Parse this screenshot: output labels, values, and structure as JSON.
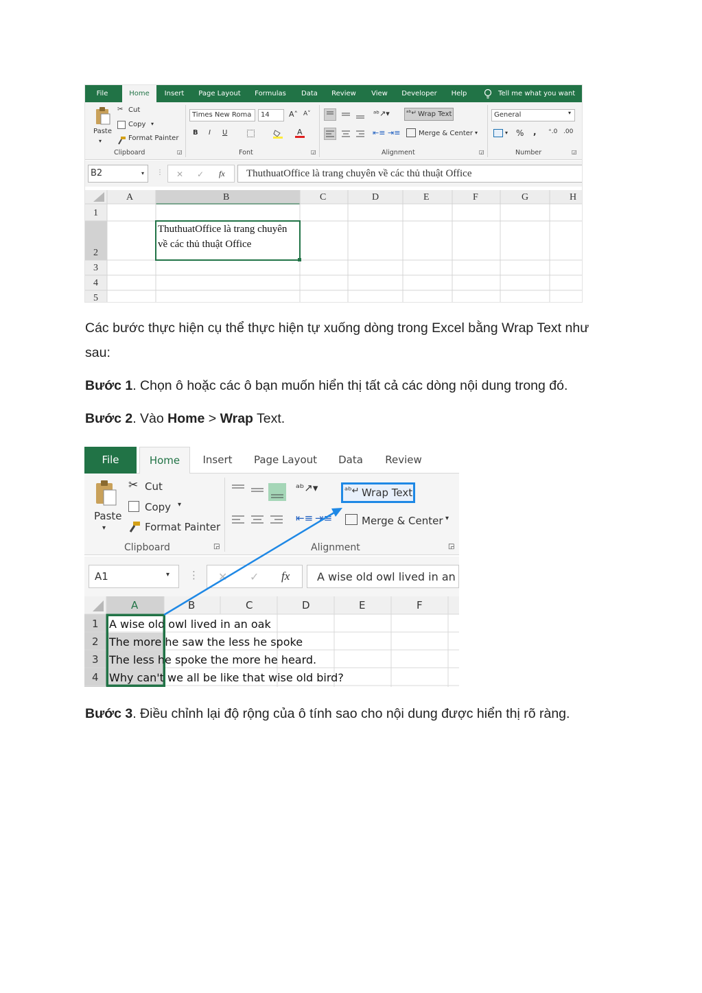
{
  "screenshot1": {
    "tabs": [
      "File",
      "Home",
      "Insert",
      "Page Layout",
      "Formulas",
      "Data",
      "Review",
      "View",
      "Developer",
      "Help"
    ],
    "tell_me": "Tell me what you want to",
    "clipboard": {
      "paste": "Paste",
      "cut": "Cut",
      "copy": "Copy",
      "format_painter": "Format Painter",
      "label": "Clipboard"
    },
    "font": {
      "name": "Times New Roma",
      "size": "14",
      "bold": "B",
      "italic": "I",
      "underline": "U",
      "label": "Font"
    },
    "alignment": {
      "wrap_text": "Wrap Text",
      "merge_center": "Merge & Center",
      "label": "Alignment"
    },
    "number": {
      "format": "General",
      "percent": "%",
      "comma": ",",
      "label": "Number"
    },
    "name_box": "B2",
    "fx": "fx",
    "formula": "ThuthuatOffice là trang chuyên về các thủ thuật Office",
    "columns": [
      "A",
      "B",
      "C",
      "D",
      "E",
      "F",
      "G",
      "H"
    ],
    "rows": [
      "1",
      "2",
      "3",
      "4",
      "5"
    ],
    "cell_b2_line1": "ThuthuatOffice là trang chuyên",
    "cell_b2_line2": "về các thủ thuật Office"
  },
  "text": {
    "intro_line1": "Các bước thực hiện cụ thể thực hiện tự xuống dòng trong Excel bằng Wrap Text như",
    "intro_line2": "sau:",
    "step1_label": "Bước 1",
    "step1_text": ". Chọn ô hoặc các ô bạn muốn hiển thị tất cả các dòng nội dung trong đó.",
    "step2_label": "Bước 2",
    "step2_text_a": ". Vào ",
    "step2_home": "Home",
    "step2_sep": " > ",
    "step2_wrap": "Wrap",
    "step2_text_b": " Text.",
    "step3_label": "Bước 3",
    "step3_text": ". Điều chỉnh lại độ rộng của ô tính sao cho nội dung được hiển thị rõ ràng."
  },
  "screenshot2": {
    "tabs": [
      "File",
      "Home",
      "Insert",
      "Page Layout",
      "Data",
      "Review"
    ],
    "clipboard": {
      "paste": "Paste",
      "cut": "Cut",
      "copy": "Copy",
      "format_painter": "Format Painter",
      "label": "Clipboard"
    },
    "alignment": {
      "wrap_text": "Wrap Text",
      "merge_center": "Merge & Center",
      "label": "Alignment"
    },
    "name_box": "A1",
    "fx": "fx",
    "formula": "A wise old owl lived in an",
    "columns": [
      "A",
      "B",
      "C",
      "D",
      "E",
      "F"
    ],
    "rows": [
      "1",
      "2",
      "3",
      "4"
    ],
    "row_text": [
      "A wise old owl lived in an oak",
      "The more he saw the less he spoke",
      "The less he spoke the more he heard.",
      "Why can't we all be like that wise old bird?"
    ]
  },
  "colors": {
    "excel_green": "#217346",
    "selection_border": "#217346",
    "arrow_blue": "#1e88e5",
    "highlight_box": "#1e88e5"
  }
}
